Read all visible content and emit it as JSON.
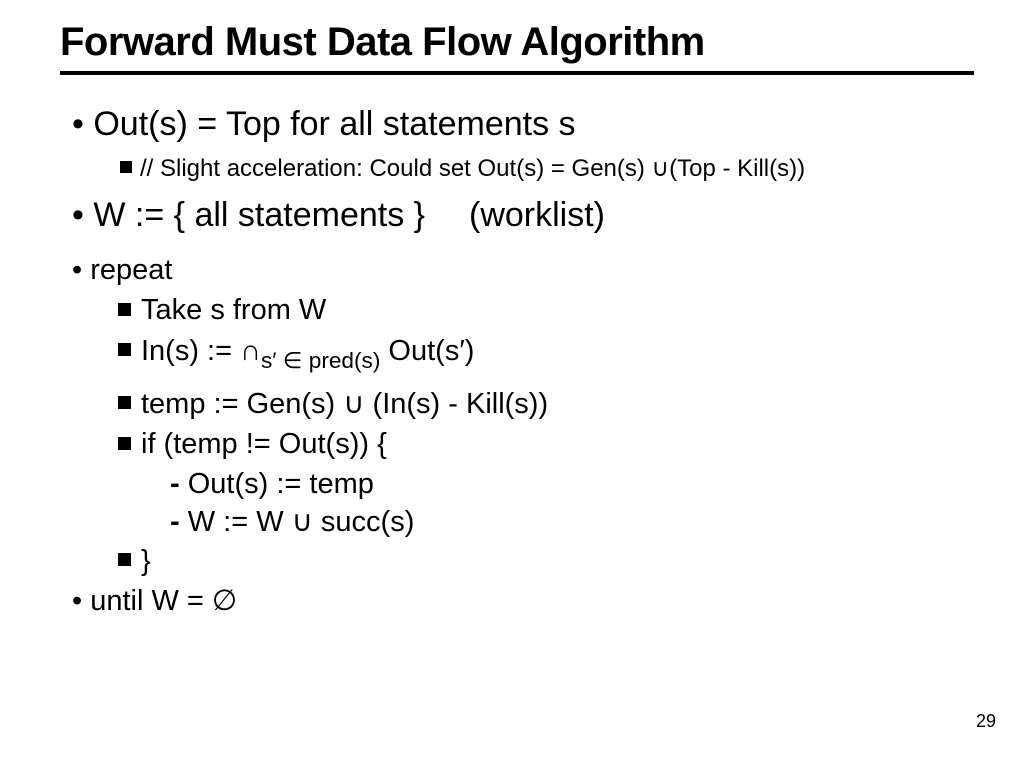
{
  "title": "Forward Must Data Flow Algorithm",
  "b1": "Out(s) = Top for all statements s",
  "b1_sub": "// Slight acceleration:  Could set Out(s) = Gen(s) ∪(Top - Kill(s))",
  "b2_a": "W := { all statements }",
  "b2_b": "(worklist)",
  "repeat": "repeat",
  "r1": "Take s from W",
  "r2_pre": "In(s) := ∩",
  "r2_sub": "s′ ∈ pred(s)",
  "r2_post": " Out(s′)",
  "r3": "temp := Gen(s) ∪ (In(s) - Kill(s))",
  "r4": "if (temp != Out(s)) {",
  "r4a": "Out(s) := temp",
  "r4b": "W := W ∪ succ(s)",
  "r5": "}",
  "until": "until W = ∅",
  "page": "29"
}
